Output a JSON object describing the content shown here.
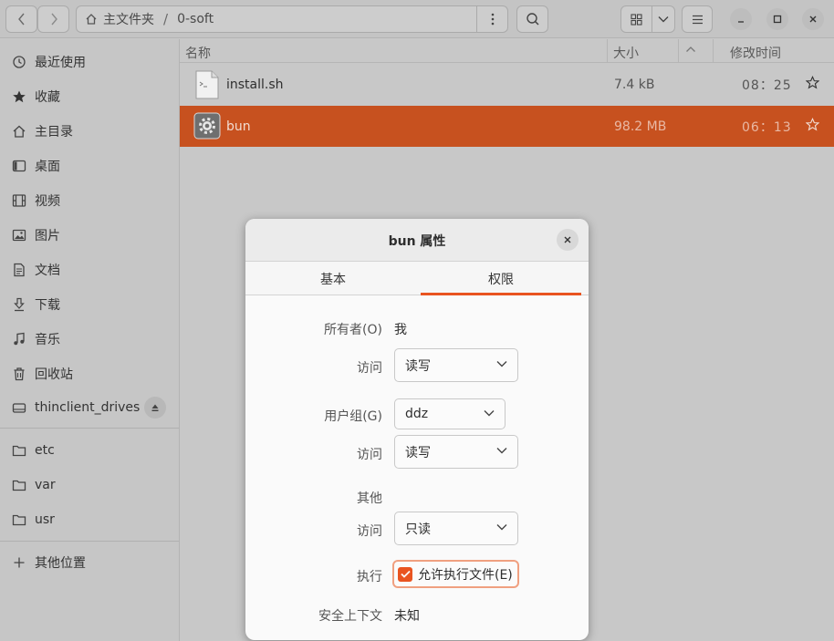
{
  "window": {
    "path_home_label": "主文件夹",
    "path_separator": "/",
    "path_current": "0-soft"
  },
  "sidebar": {
    "items": [
      {
        "label": "最近使用",
        "icon": "clock-icon"
      },
      {
        "label": "收藏",
        "icon": "star-icon"
      },
      {
        "label": "主目录",
        "icon": "home-icon"
      },
      {
        "label": "桌面",
        "icon": "desktop-icon"
      },
      {
        "label": "视频",
        "icon": "video-icon"
      },
      {
        "label": "图片",
        "icon": "picture-icon"
      },
      {
        "label": "文档",
        "icon": "document-icon"
      },
      {
        "label": "下载",
        "icon": "download-icon"
      },
      {
        "label": "音乐",
        "icon": "music-icon"
      },
      {
        "label": "回收站",
        "icon": "trash-icon"
      }
    ],
    "drive": {
      "label": "thinclient_drives",
      "icon": "drive-icon"
    },
    "bookmarks": [
      {
        "label": "etc",
        "icon": "folder-icon"
      },
      {
        "label": "var",
        "icon": "folder-icon"
      },
      {
        "label": "usr",
        "icon": "folder-icon"
      }
    ],
    "other_locations": "其他位置"
  },
  "list": {
    "columns": {
      "name": "名称",
      "size": "大小",
      "modified": "修改时间"
    },
    "rows": [
      {
        "name": "install.sh",
        "size": "7.4 kB",
        "time": "08：25",
        "selected": false,
        "icon": "script-file-icon"
      },
      {
        "name": "bun",
        "size": "98.2 MB",
        "time": "06：13",
        "selected": true,
        "icon": "executable-file-icon"
      }
    ]
  },
  "dialog": {
    "title": "bun 属性",
    "tabs": [
      "基本",
      "权限"
    ],
    "active_tab": "权限",
    "owner_label": "所有者(O)",
    "owner_value": "我",
    "access_label": "访问",
    "owner_access": "读写",
    "group_label": "用户组(G)",
    "group_value": "ddz",
    "group_access": "读写",
    "others_label": "其他",
    "others_access": "只读",
    "exec_label": "执行",
    "exec_checkbox": "允许执行文件(E)",
    "exec_checked": true,
    "context_label": "安全上下文",
    "context_value": "未知"
  },
  "colors": {
    "accent": "#e95420",
    "selection": "#c7511f"
  }
}
